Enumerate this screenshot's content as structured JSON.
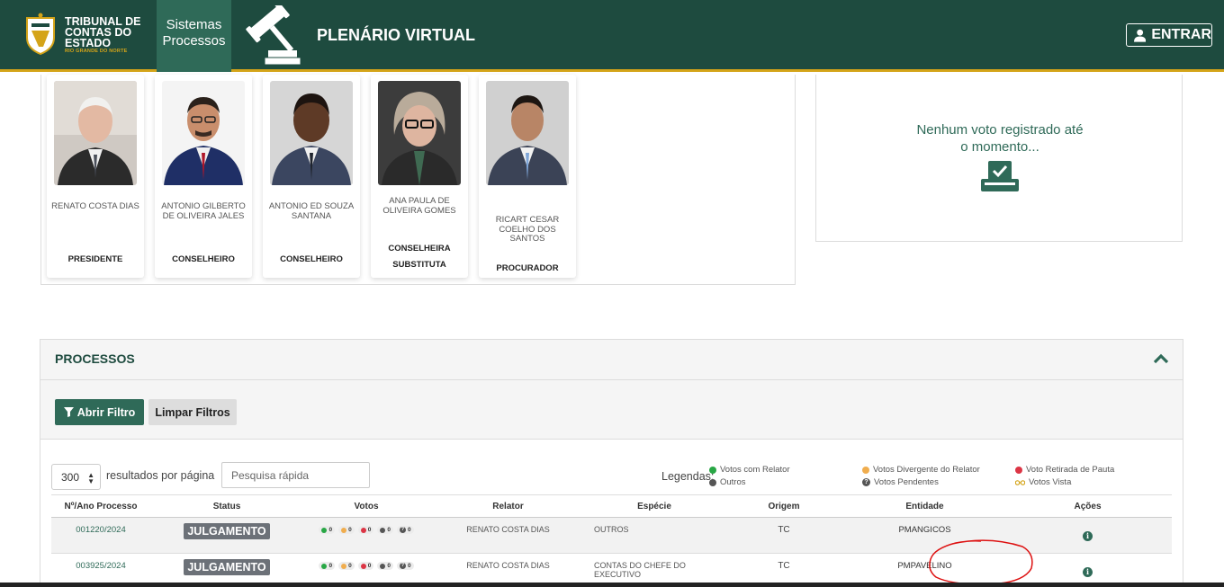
{
  "header": {
    "logo_line1": "TRIBUNAL DE",
    "logo_line2": "CONTAS DO",
    "logo_line3": "ESTADO",
    "logo_sub": "RIO GRANDE DO NORTE",
    "sistemas_line1": "Sistemas",
    "sistemas_line2": "Processos",
    "app_title": "PLENÁRIO VIRTUAL",
    "login_label": "ENTRAR",
    "colors": {
      "bar": "#1e4b3f",
      "accent": "#d4a419",
      "highlight": "#2f6a58"
    }
  },
  "members": [
    {
      "name": "RENATO COSTA DIAS",
      "role": "PRESIDENTE"
    },
    {
      "name": "ANTONIO GILBERTO DE OLIVEIRA JALES",
      "role": "CONSELHEIRO"
    },
    {
      "name": "ANTONIO ED SOUZA SANTANA",
      "role": "CONSELHEIRO"
    },
    {
      "name": "ANA PAULA DE OLIVEIRA GOMES",
      "role": "CONSELHEIRA SUBSTITUTA"
    },
    {
      "name": "RICART CESAR COELHO DOS SANTOS",
      "role": "PROCURADOR"
    }
  ],
  "votes_panel": {
    "message_line1": "Nenhum voto registrado até",
    "message_line2": "o momento...",
    "icon": "ballot-box-check-icon"
  },
  "processos": {
    "title": "PROCESSOS",
    "open_filter": "Abrir Filtro",
    "clear_filters": "Limpar Filtros",
    "per_page_value": "300",
    "per_page_label": "resultados por página",
    "search_placeholder": "Pesquisa rápida",
    "legend_label": "Legendas:",
    "legend": [
      {
        "label": "Votos com Relator",
        "color": "#28a745"
      },
      {
        "label": "Outros",
        "color": "#555555"
      },
      {
        "label": "Votos Divergente do Relator",
        "color": "#f0ad4e"
      },
      {
        "label": "Votos Pendentes",
        "icon": "question-circle-icon"
      },
      {
        "label": "Voto Retirada de Pauta",
        "color": "#dc3545"
      },
      {
        "label": "Votos Vista",
        "icon": "glasses-icon",
        "color": "#d4a419"
      }
    ],
    "columns": [
      "Nº/Ano Processo",
      "Status",
      "Votos",
      "Relator",
      "Espécie",
      "Origem",
      "Entidade",
      "Ações"
    ],
    "rows": [
      {
        "numero": "001220/2024",
        "status": "JULGAMENTO",
        "votes": [
          "0",
          "0",
          "0",
          "0",
          "0"
        ],
        "relator": "RENATO COSTA DIAS",
        "especie": "OUTROS",
        "origem": "TC",
        "entidade": "PMANGICOS"
      },
      {
        "numero": "003925/2024",
        "status": "JULGAMENTO",
        "votes": [
          "0",
          "0",
          "0",
          "0",
          "0"
        ],
        "relator": "RENATO COSTA DIAS",
        "especie": "CONTAS DO CHEFE DO EXECUTIVO",
        "origem": "TC",
        "entidade": "PMPAVELINO"
      }
    ]
  }
}
